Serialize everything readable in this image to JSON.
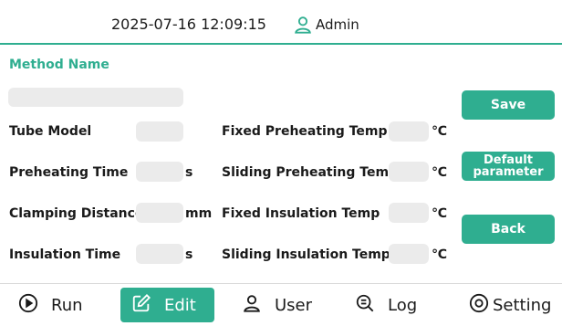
{
  "header": {
    "datetime": "2025-07-16 12:09:15",
    "user": "Admin"
  },
  "form": {
    "section_title": "Method Name",
    "method_name_value": "",
    "fields": {
      "tube_model": {
        "label": "Tube Model",
        "value": "",
        "unit": ""
      },
      "preheating_time": {
        "label": "Preheating Time",
        "value": "",
        "unit": "s"
      },
      "clamping_distance": {
        "label": "Clamping Distance",
        "value": "",
        "unit": "mm"
      },
      "insulation_time": {
        "label": "Insulation Time",
        "value": "",
        "unit": "s"
      },
      "fixed_preheating_temp": {
        "label": "Fixed Preheating Temp",
        "value": "",
        "unit": "℃"
      },
      "sliding_preheating_temp": {
        "label": "Sliding Preheating Temp",
        "value": "",
        "unit": "℃"
      },
      "fixed_insulation_temp": {
        "label": "Fixed Insulation Temp",
        "value": "",
        "unit": "℃"
      },
      "sliding_insulation_temp": {
        "label": "Sliding Insulation Temp",
        "value": "",
        "unit": "℃"
      }
    }
  },
  "actions": {
    "save": "Save",
    "default_line1": "Default",
    "default_line2": "parameter",
    "back": "Back"
  },
  "nav": {
    "run": "Run",
    "edit": "Edit",
    "user": "User",
    "log": "Log",
    "setting": "Setting",
    "active": "edit"
  },
  "colors": {
    "accent": "#2fae90",
    "field_bg": "#ebebeb"
  }
}
